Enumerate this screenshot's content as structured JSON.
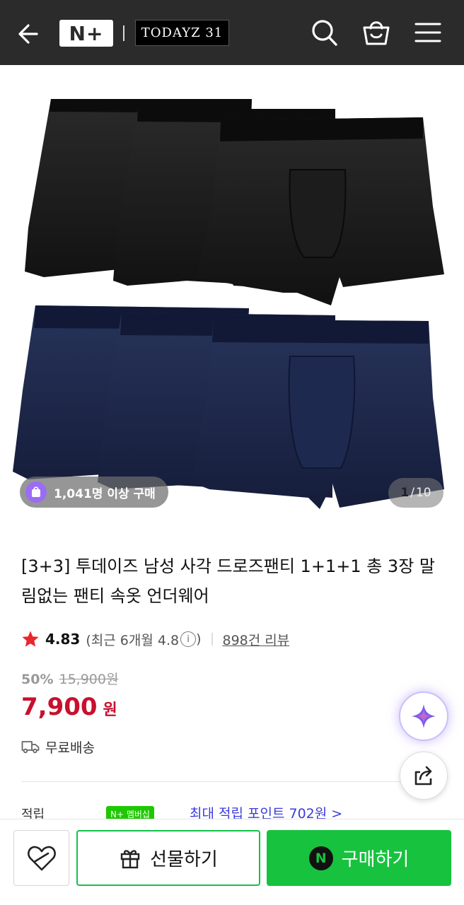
{
  "header": {
    "nplus_logo": "N+",
    "brand_logo": "TODAYZ 31"
  },
  "image": {
    "purchase_badge": "1,041명 이상 구매",
    "counter_current": "1",
    "counter_sep": "/",
    "counter_total": "10"
  },
  "product": {
    "title": "[3+3] 투데이즈 남성 사각 드로즈팬티 1+1+1 총 3장 말림없는 팬티 속옷 언더웨어",
    "rating": "4.83",
    "recent_rating": "(최근 6개월 4.8",
    "info_mark": "i",
    "recent_close": ")",
    "review_count": "898건 리뷰",
    "discount": "50%",
    "original_price": "15,900원",
    "price": "7,900",
    "price_unit": "원",
    "shipping": "무료배송",
    "points_label": "적립",
    "points_badge": "N+ 멤버십",
    "points_text": "최대 적립 포인트 702원 >"
  },
  "bottom_bar": {
    "gift_label": "선물하기",
    "buy_label": "구매하기",
    "npay_mark": "N"
  },
  "colors": {
    "header_bg": "#2b2b2b",
    "price_red": "#c8102e",
    "buy_green": "#17c23e",
    "badge_purple": "#9b6cf5"
  },
  "icons": [
    "back-arrow-icon",
    "search-icon",
    "shopping-bag-icon",
    "hamburger-menu-icon",
    "star-icon",
    "info-icon",
    "truck-icon",
    "ai-sparkle-icon",
    "share-icon",
    "heart-icon",
    "gift-icon",
    "npay-icon"
  ]
}
